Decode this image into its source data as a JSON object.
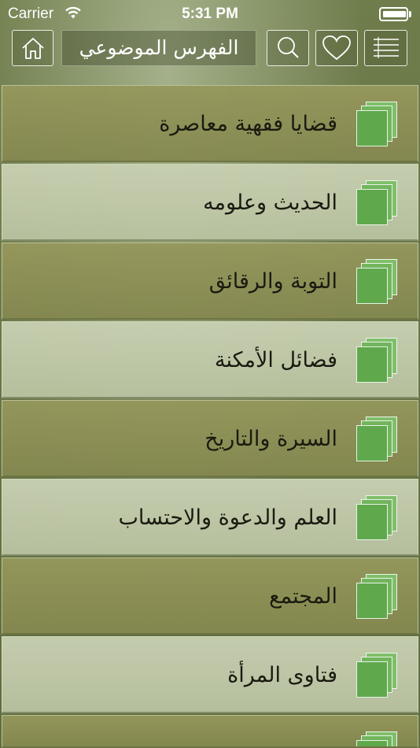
{
  "status_bar": {
    "carrier": "Carrier",
    "time": "5:31 PM"
  },
  "toolbar": {
    "title": "الفهرس الموضوعي",
    "home_icon": "home-icon",
    "search_icon": "search-icon",
    "favorites_icon": "heart-icon",
    "menu_icon": "list-menu-icon"
  },
  "categories": [
    {
      "label": "قضايا فقهية معاصرة",
      "icon": "stacked-pages-icon"
    },
    {
      "label": "الحديث وعلومه",
      "icon": "stacked-pages-icon"
    },
    {
      "label": "التوبة والرقائق",
      "icon": "stacked-pages-icon"
    },
    {
      "label": "فضائل الأمكنة",
      "icon": "stacked-pages-icon"
    },
    {
      "label": "السيرة والتاريخ",
      "icon": "stacked-pages-icon"
    },
    {
      "label": "العلم والدعوة والاحتساب",
      "icon": "stacked-pages-icon"
    },
    {
      "label": "المجتمع",
      "icon": "stacked-pages-icon"
    },
    {
      "label": "فتاوى المرأة",
      "icon": "stacked-pages-icon"
    },
    {
      "label": "",
      "icon": "stacked-pages-icon"
    }
  ],
  "colors": {
    "background": "#5f6d3f",
    "row_dark": "#8e9258",
    "row_light": "#bcc5a2",
    "icon_green": "#5fa94c",
    "text": "#1a1a10"
  }
}
